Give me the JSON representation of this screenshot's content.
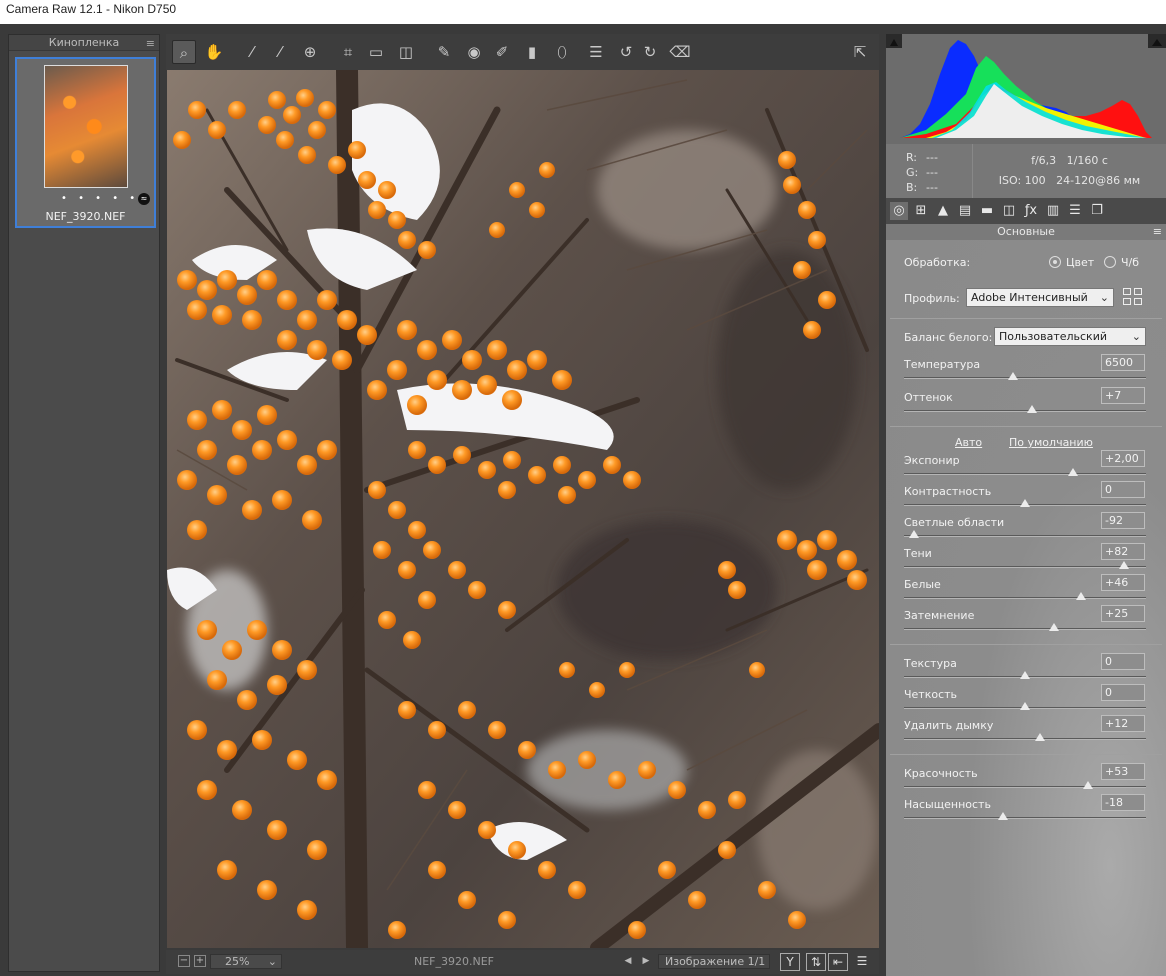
{
  "window": {
    "title": "Camera Raw 12.1  -  Nikon D750"
  },
  "filmstrip": {
    "title": "Кинопленка",
    "items": [
      {
        "filename": "NEF_3920.NEF",
        "rating_dots": "• • • • •"
      }
    ]
  },
  "toolbar": {
    "tools": [
      "zoom-icon",
      "hand-icon",
      "white-balance-icon",
      "color-sampler-icon",
      "targeted-adjustment-icon",
      "crop-icon",
      "straighten-icon",
      "transform-icon",
      "spot-removal-icon",
      "red-eye-icon",
      "adjustment-brush-icon",
      "graduated-filter-icon",
      "radial-filter-icon",
      "preferences-icon",
      "rotate-ccw-icon",
      "rotate-cw-icon",
      "trash-icon",
      "fullscreen-icon"
    ]
  },
  "bottombar": {
    "zoom": "25%",
    "filename": "NEF_3920.NEF",
    "image_count": "Изображение 1/1"
  },
  "info": {
    "r_label": "R:",
    "g_label": "G:",
    "b_label": "B:",
    "r": "---",
    "g": "---",
    "b": "---",
    "aperture": "f/6,3",
    "shutter": "1/160 с",
    "iso": "ISO: 100",
    "lens": "24-120@86 мм"
  },
  "panel": {
    "section_title": "Основные",
    "treatment_label": "Обработка:",
    "treatment_color": "Цвет",
    "treatment_bw": "Ч/б",
    "profile_label": "Профиль:",
    "profile_value": "Adobe Интенсивный",
    "wb_label": "Баланс белого:",
    "wb_value": "Пользовательский",
    "auto_link": "Авто",
    "default_link": "По умолчанию",
    "sliders": [
      {
        "label": "Температура",
        "value": "6500",
        "pos": 0.45
      },
      {
        "label": "Оттенок",
        "value": "+7",
        "pos": 0.53
      },
      {
        "label": "Экспонир",
        "value": "+2,00",
        "pos": 0.7
      },
      {
        "label": "Контрастность",
        "value": "0",
        "pos": 0.5
      },
      {
        "label": "Светлые области",
        "value": "-92",
        "pos": 0.04
      },
      {
        "label": "Тени",
        "value": "+82",
        "pos": 0.91
      },
      {
        "label": "Белые",
        "value": "+46",
        "pos": 0.73
      },
      {
        "label": "Затемнение",
        "value": "+25",
        "pos": 0.62
      },
      {
        "label": "Текстура",
        "value": "0",
        "pos": 0.5
      },
      {
        "label": "Четкость",
        "value": "0",
        "pos": 0.5
      },
      {
        "label": "Удалить дымку",
        "value": "+12",
        "pos": 0.56
      },
      {
        "label": "Красочность",
        "value": "+53",
        "pos": 0.76
      },
      {
        "label": "Насыщенность",
        "value": "-18",
        "pos": 0.41
      }
    ]
  },
  "colors": {
    "accent": "#3f7fd8",
    "panel_bg": "#8f8f8f",
    "berries": "#ff8c1a"
  }
}
